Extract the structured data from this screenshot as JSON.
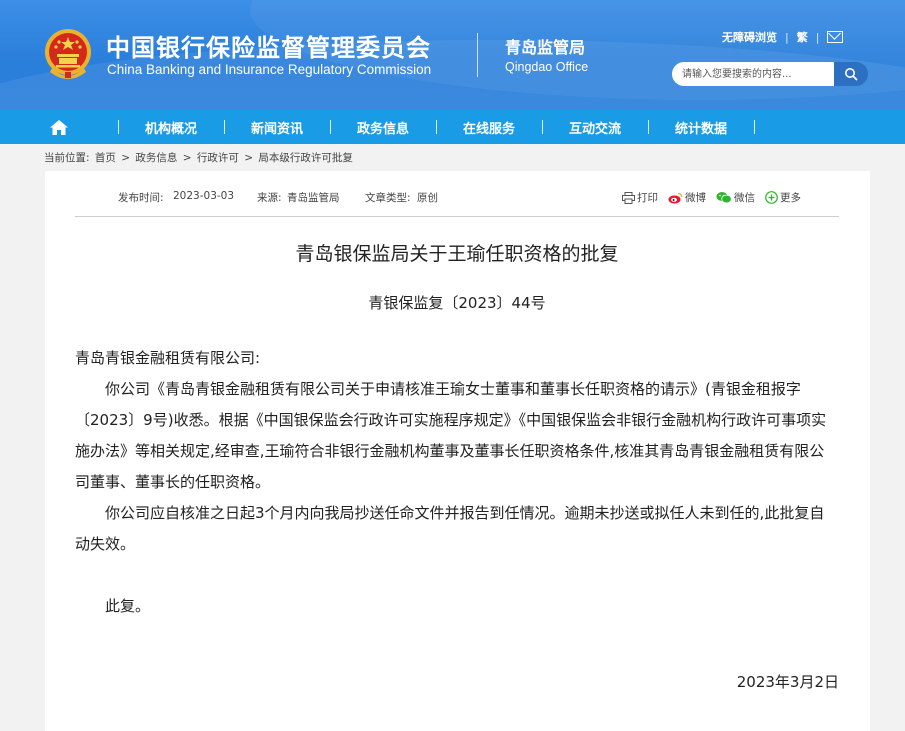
{
  "header": {
    "title_cn": "中国银行保险监督管理委员会",
    "title_en": "China Banking and Insurance Regulatory Commission",
    "office_cn": "青岛监管局",
    "office_en": "Qingdao Office",
    "toplinks": {
      "accessibility": "无障碍浏览",
      "traditional": "繁",
      "mail_icon": "mail-icon"
    },
    "search": {
      "placeholder": "请输入您要搜索的内容...",
      "icon": "search-icon"
    },
    "emblem_icon": "national-emblem-icon"
  },
  "nav": {
    "home_icon": "home-icon",
    "items": [
      "机构概况",
      "新闻资讯",
      "政务信息",
      "在线服务",
      "互动交流",
      "统计数据"
    ]
  },
  "breadcrumb": {
    "label": "当前位置:",
    "path": [
      "首页",
      "政务信息",
      "行政许可",
      "局本级行政许可批复"
    ],
    "separator": ">"
  },
  "article": {
    "meta": {
      "publish_label": "发布时间:",
      "publish_date": "2023-03-03",
      "source_label": "来源:",
      "source": "青岛监管局",
      "type_label": "文章类型:",
      "type": "原创"
    },
    "share": {
      "print": "打印",
      "weibo": "微博",
      "wechat": "微信",
      "more": "更多"
    },
    "title": "青岛银保监局关于王瑜任职资格的批复",
    "doc_no": "青银保监复〔2023〕44号",
    "salutation": "青岛青银金融租赁有限公司:",
    "paragraph1": "你公司《青岛青银金融租赁有限公司关于申请核准王瑜女士董事和董事长任职资格的请示》(青银金租报字〔2023〕9号)收悉。根据《中国银保监会行政许可实施程序规定》《中国银保监会非银行金融机构行政许可事项实施办法》等相关规定,经审查,王瑜符合非银行金融机构董事及董事长任职资格条件,核准其青岛青银金融租赁有限公司董事、董事长的任职资格。",
    "paragraph2": "你公司应自核准之日起3个月内向我局抄送任命文件并报告到任情况。逾期未抄送或拟任人未到任的,此批复自动失效。",
    "closing": "此复。",
    "date": "2023年3月2日"
  },
  "colors": {
    "header_blue": "#2a7fdb",
    "nav_blue": "#1a9be6",
    "page_bg": "#f2f2f2"
  }
}
